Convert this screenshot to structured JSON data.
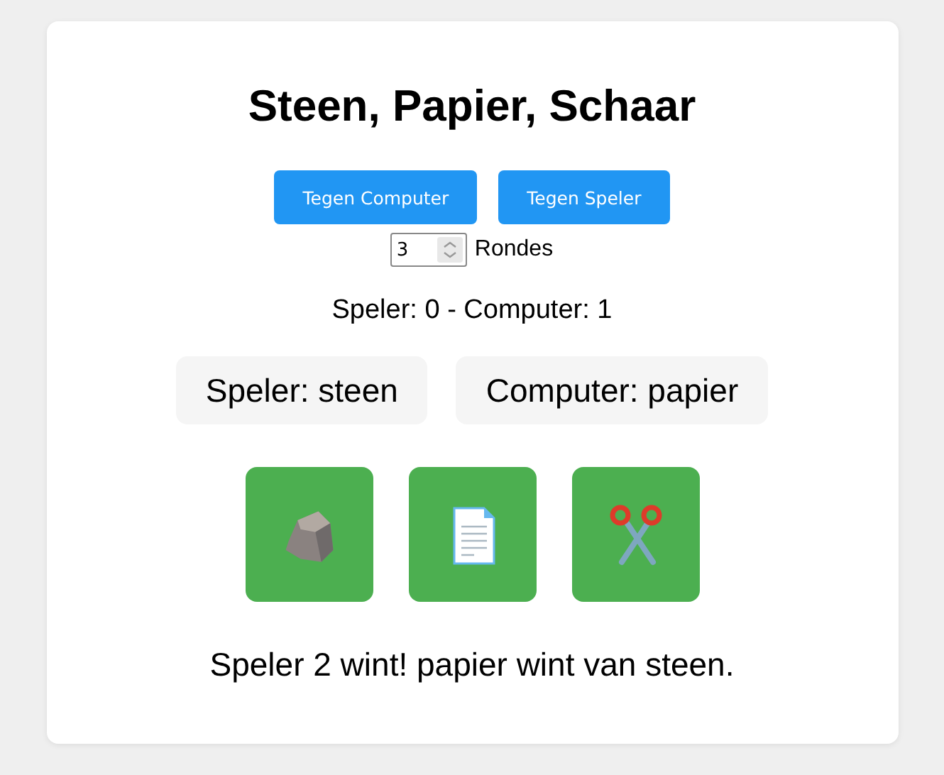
{
  "title": "Steen, Papier, Schaar",
  "modes": [
    "Tegen Computer",
    "Tegen Speler"
  ],
  "rounds": {
    "value": "3",
    "label": "Rondes"
  },
  "score": "Speler: 0 - Computer: 1",
  "picks": [
    "Speler: steen",
    "Computer: papier"
  ],
  "choices": [
    {
      "kind": "rock"
    },
    {
      "kind": "paper"
    },
    {
      "kind": "scissors"
    }
  ],
  "result": "Speler 2 wint! papier wint van steen."
}
